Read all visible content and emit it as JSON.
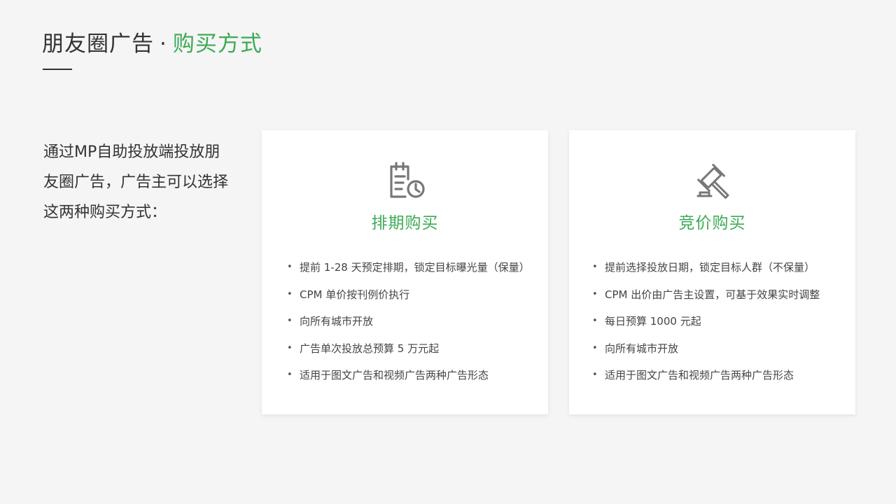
{
  "header": {
    "title_main": "朋友圈广告",
    "separator": "·",
    "title_accent": "购买方式"
  },
  "intro": {
    "text": "通过MP自助投放端投放朋友圈广告，广告主可以选择这两种购买方式："
  },
  "cards": [
    {
      "icon": "schedule-document-clock-icon",
      "title": "排期购买",
      "bullets": [
        "提前 1-28 天预定排期，锁定目标曝光量（保量）",
        "CPM 单价按刊例价执行",
        "向所有城市开放",
        "广告单次投放总预算 5 万元起",
        "适用于图文广告和视频广告两种广告形态"
      ]
    },
    {
      "icon": "auction-gavel-icon",
      "title": "竞价购买",
      "bullets": [
        "提前选择投放日期，锁定目标人群（不保量）",
        "CPM 出价由广告主设置，可基于效果实时调整",
        "每日预算 1000 元起",
        "向所有城市开放",
        "适用于图文广告和视频广告两种广告形态"
      ]
    }
  ],
  "bullet_symbol": "•",
  "colors": {
    "accent": "#3daa55",
    "text": "#333333",
    "background": "#f5f5f5",
    "icon": "#777777"
  }
}
